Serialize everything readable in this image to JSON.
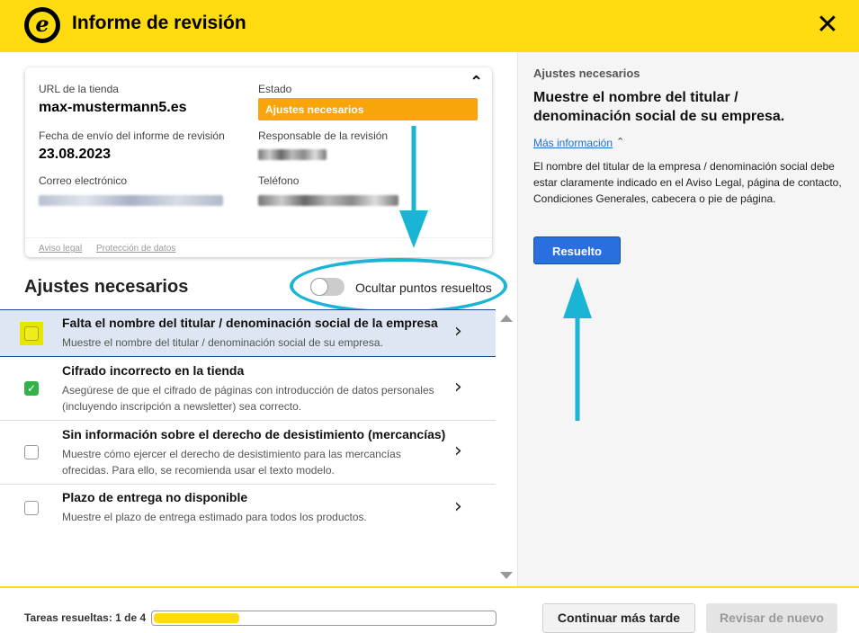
{
  "header": {
    "title": "Informe de revisión",
    "logo_letter": "e",
    "close_glyph": "✕"
  },
  "card": {
    "url_label": "URL de la tienda",
    "url_value": "max-mustermann5.es",
    "status_label": "Estado",
    "status_value": "Ajustes necesarios",
    "date_label": "Fecha de envío del informe de revisión",
    "date_value": "23.08.2023",
    "responsible_label": "Responsable de la revisión",
    "email_label": "Correo electrónico",
    "phone_label": "Teléfono",
    "legal_link": "Aviso legal",
    "privacy_link": "Protección de datos",
    "collapse_glyph": "⌃"
  },
  "section": {
    "title": "Ajustes necesarios",
    "toggle_label": "Ocultar puntos resueltos"
  },
  "items": [
    {
      "title": "Falta el nombre del titular / denominación social de la empresa",
      "desc": "Muestre el nombre del titular / denominación social de su empresa.",
      "checked": false
    },
    {
      "title": "Cifrado incorrecto en la tienda",
      "desc": "Asegúrese de que el cifrado de páginas con introducción de datos personales (incluyendo inscripción a newsletter) sea correcto.",
      "checked": true
    },
    {
      "title": "Sin información sobre el derecho de desistimiento (mercancías)",
      "desc": "Muestre cómo ejercer el derecho de desistimiento para las mercancías ofrecidas. Para ello, se recomienda usar el texto modelo.",
      "checked": false
    },
    {
      "title": "Plazo de entrega no disponible",
      "desc": "Muestre el plazo de entrega estimado para todos los productos.",
      "checked": false
    }
  ],
  "detail": {
    "small_title": "Ajustes necesarios",
    "title": "Muestre el nombre del titular / denominación social de su empresa.",
    "more_link": "Más información",
    "body": "El nombre del titular de la empresa / denominación social debe estar claramente indicado en el Aviso Legal, página de contacto, Condiciones Generales, cabecera o pie de página.",
    "resolve_button": "Resuelto"
  },
  "footer": {
    "progress_label": "Tareas resueltas: 1 de 4",
    "progress_fraction": 0.25,
    "later_button": "Continuar más tarde",
    "review_button": "Revisar de nuevo"
  },
  "colors": {
    "brand": "#ffdc0f",
    "status": "#f7a50a",
    "accent": "#2a6fe0",
    "annotation": "#1ab5d5",
    "success": "#35b14a"
  }
}
